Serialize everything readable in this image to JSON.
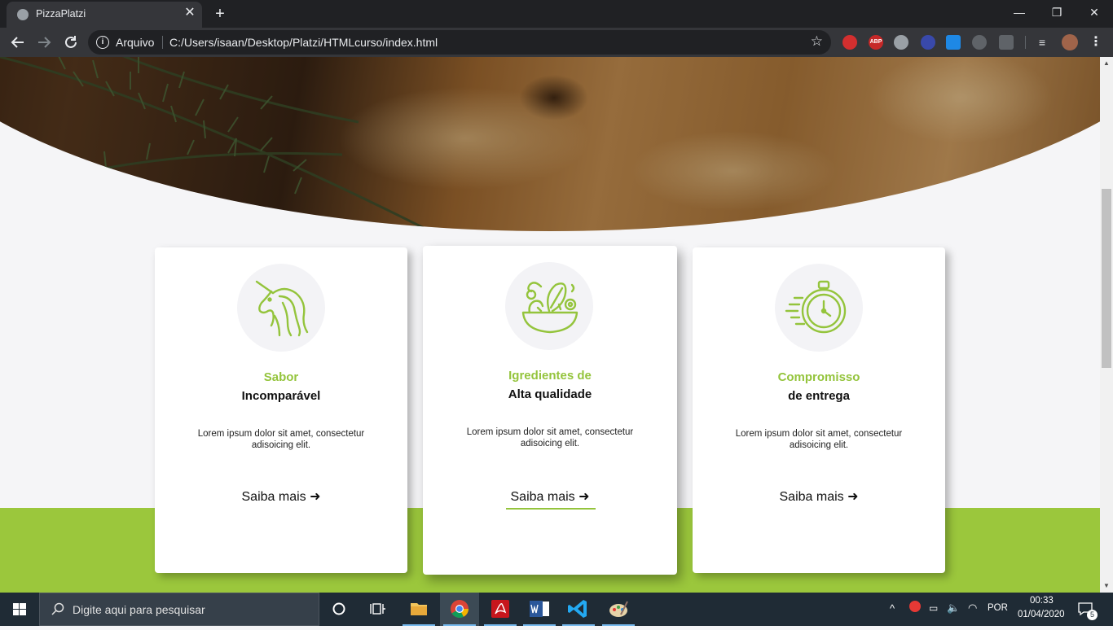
{
  "browser": {
    "tab_title": "PizzaPlatzi",
    "close_tab": "✕",
    "new_tab": "+",
    "address_prefix": "Arquivo",
    "url": "C:/Users/isaan/Desktop/Platzi/HTMLcurso/index.html",
    "window_controls": {
      "minimize": "—",
      "restore": "❐",
      "close": "✕"
    },
    "extensions": [
      "ABP"
    ]
  },
  "cards": [
    {
      "icon": "unicorn-icon",
      "kicker": "Sabor",
      "title": "Incomparável",
      "text": "Lorem ipsum dolor sit amet, consectetur adisoicing elit.",
      "link": "Saiba mais ➜"
    },
    {
      "icon": "salad-bowl-icon",
      "kicker": "Igredientes de",
      "title": "Alta qualidade",
      "text": "Lorem ipsum dolor sit amet, consectetur adisoicing elit.",
      "link": "Saiba mais ➜"
    },
    {
      "icon": "stopwatch-icon",
      "kicker": "Compromisso",
      "title": "de entrega",
      "text": "Lorem ipsum dolor sit amet, consectetur adisoicing elit.",
      "link": "Saiba mais ➜"
    }
  ],
  "colors": {
    "accent_green": "#94c43c",
    "band_green": "#9bc73c",
    "browser_dark": "#202124",
    "taskbar": "#1f2b35"
  },
  "taskbar": {
    "search_placeholder": "Digite aqui para pesquisar",
    "language": "POR",
    "time": "00:33",
    "date": "01/04/2020",
    "notifications": "5"
  }
}
